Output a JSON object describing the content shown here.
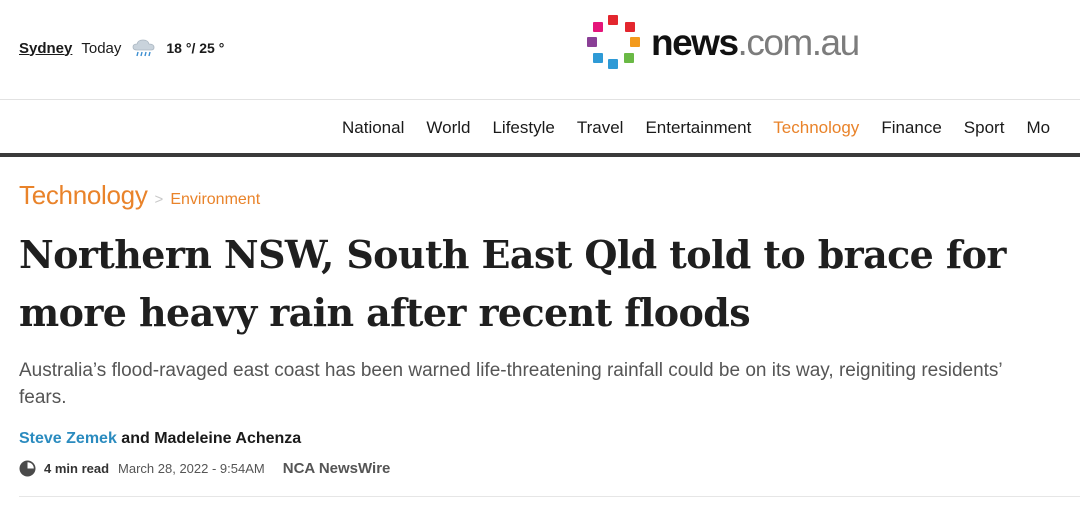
{
  "weather": {
    "city": "Sydney",
    "day": "Today",
    "icon": "cloud-rain-icon",
    "temps": "18 °/ 25 °"
  },
  "logo": {
    "word_bold": "news",
    "word_light": ".com.au",
    "colors": [
      "#e3262e",
      "#f39a1d",
      "#6ab945",
      "#2e9ad6",
      "#8a3f96",
      "#e5157a"
    ]
  },
  "nav": {
    "items": [
      "National",
      "World",
      "Lifestyle",
      "Travel",
      "Entertainment",
      "Technology",
      "Finance",
      "Sport",
      "Mo"
    ],
    "active": "Technology"
  },
  "breadcrumb": {
    "section": "Technology",
    "separator": ">",
    "subsection": "Environment"
  },
  "article": {
    "headline": "Northern NSW, South East Qld told to brace for more heavy rain after recent floods",
    "standfirst": "Australia’s flood-ravaged east coast has been warned life-threatening rainfall could be on its way, reigniting residents’ fears.",
    "author_1": "Steve Zemek",
    "author_joiner": " and ",
    "author_2": "Madeleine Achenza",
    "read_time": "4 min read",
    "date": "March 28, 2022 - 9:54AM",
    "source": "NCA NewsWire"
  },
  "colors": {
    "accent": "#e9832a",
    "author_link": "#2a8bbf"
  }
}
